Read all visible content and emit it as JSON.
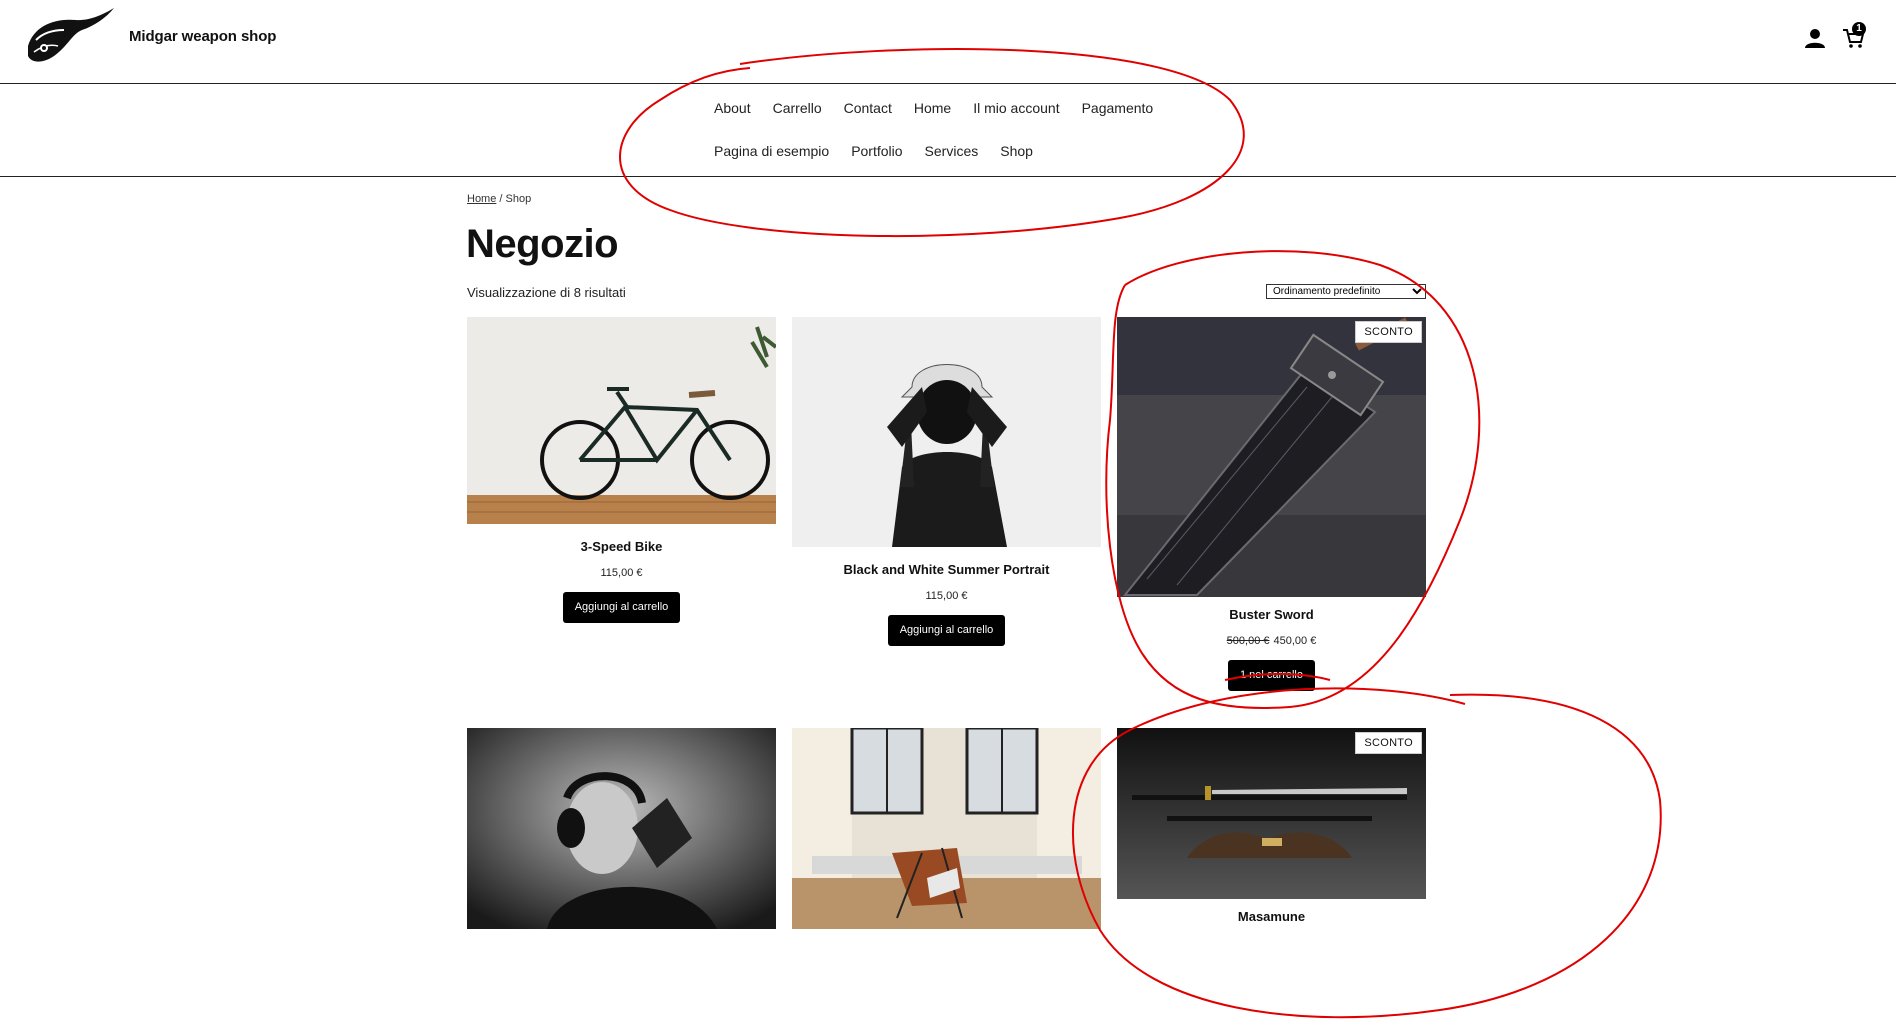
{
  "header": {
    "site_title": "Midgar weapon shop",
    "account_icon": "user-icon",
    "cart_icon": "cart-icon",
    "cart_count": "1"
  },
  "nav": {
    "row1": [
      "About",
      "Carrello",
      "Contact",
      "Home",
      "Il mio account",
      "Pagamento"
    ],
    "row2": [
      "Pagina di esempio",
      "Portfolio",
      "Services",
      "Shop"
    ]
  },
  "breadcrumb": {
    "home": "Home",
    "separator": " / ",
    "current": "Shop"
  },
  "page_title": "Negozio",
  "result_count": "Visualizzazione di 8 risultati",
  "ordering": {
    "selected": "Ordinamento predefinito"
  },
  "products": [
    {
      "name": "3-Speed Bike",
      "price": "115,00 €",
      "button": "Aggiungi al carrello"
    },
    {
      "name": "Black and White Summer Portrait",
      "price": "115,00 €",
      "button": "Aggiungi al carrello"
    },
    {
      "name": "Buster Sword",
      "badge": "SCONTO",
      "old_price": "500,00 €",
      "price": "450,00 €",
      "button": "1 nel carrello"
    },
    {
      "name": "",
      "image": "man-with-headphones"
    },
    {
      "name": "",
      "image": "butterfly-chair-by-window"
    },
    {
      "name": "Masamune",
      "badge": "SCONTO"
    }
  ],
  "colors": {
    "annotation": "#e00000",
    "button": "#000000"
  }
}
